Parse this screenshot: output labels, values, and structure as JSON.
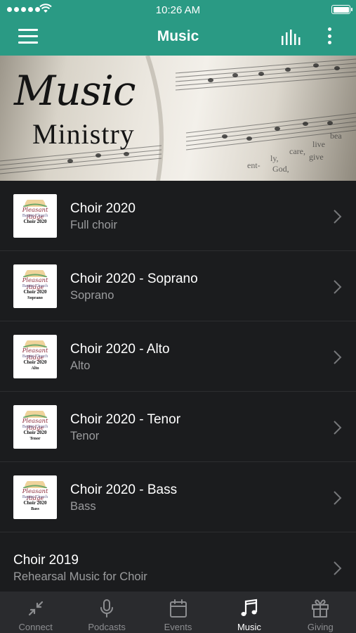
{
  "status": {
    "time": "10:26 AM"
  },
  "nav": {
    "title": "Music"
  },
  "banner": {
    "script": "Music",
    "caps": "Ministry"
  },
  "thumb": {
    "script": "Pleasant Ridge",
    "sub": "Baptist Church",
    "title": "Choir 2020"
  },
  "items": [
    {
      "title": "Choir 2020",
      "subtitle": "Full choir",
      "thumb_voice": ""
    },
    {
      "title": "Choir 2020 - Soprano",
      "subtitle": "Soprano",
      "thumb_voice": "Soprano"
    },
    {
      "title": "Choir 2020 - Alto",
      "subtitle": "Alto",
      "thumb_voice": "Alto"
    },
    {
      "title": "Choir 2020 - Tenor",
      "subtitle": "Tenor",
      "thumb_voice": "Tenor"
    },
    {
      "title": "Choir 2020 - Bass",
      "subtitle": "Bass",
      "thumb_voice": "Bass"
    },
    {
      "title": "Choir 2019",
      "subtitle": "Rehearsal Music for Choir"
    }
  ],
  "tabs": [
    {
      "label": "Connect",
      "icon": "connect-arrows-icon"
    },
    {
      "label": "Podcasts",
      "icon": "microphone-icon"
    },
    {
      "label": "Events",
      "icon": "calendar-icon"
    },
    {
      "label": "Music",
      "icon": "music-note-icon",
      "active": true
    },
    {
      "label": "Giving",
      "icon": "gift-icon"
    }
  ],
  "colors": {
    "accent": "#2a9a84",
    "background": "#1b1c1e",
    "tabbar": "#2a2b2e"
  }
}
